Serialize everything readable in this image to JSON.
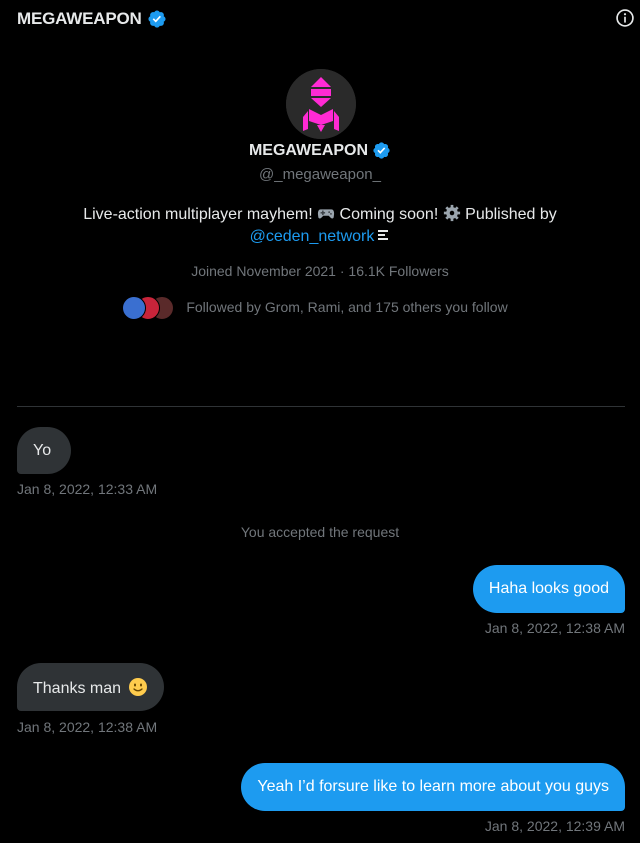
{
  "header": {
    "title": "MEGAWEAPON",
    "verified_icon": "verified-badge-icon",
    "info_icon": "info-icon"
  },
  "profile": {
    "name": "MEGAWEAPON",
    "handle": "@_megaweapon_",
    "bio_part1": "Live-action multiplayer mayhem! ",
    "bio_emoji1": "game-controller-emoji",
    "bio_part2": " Coming soon! ",
    "bio_emoji2": "gear-emoji",
    "bio_part3": " Published by",
    "bio_mention": "@ceden_network",
    "joined": "Joined November 2021 · 16.1K Followers",
    "followed_by": "Followed by Grom, Rami, and 175 others you follow"
  },
  "messages": [
    {
      "direction": "incoming",
      "text": "Yo",
      "timestamp": "Jan 8, 2022, 12:33 AM"
    },
    {
      "direction": "system",
      "text": "You accepted the request"
    },
    {
      "direction": "outgoing",
      "text": "Haha looks good",
      "timestamp": "Jan 8, 2022, 12:38 AM"
    },
    {
      "direction": "incoming",
      "text": "Thanks man",
      "emoji": "slightly-smiling-face-emoji",
      "timestamp": "Jan 8, 2022, 12:38 AM"
    },
    {
      "direction": "outgoing",
      "text": "Yeah I’d forsure like to learn more about you guys",
      "timestamp": "Jan 8, 2022, 12:39 AM"
    }
  ],
  "colors": {
    "background": "#000000",
    "accent": "#1d9bf0",
    "incoming_bubble": "#2f3336",
    "muted_text": "#71767b",
    "avatar_logo": "#ff2ad4"
  }
}
